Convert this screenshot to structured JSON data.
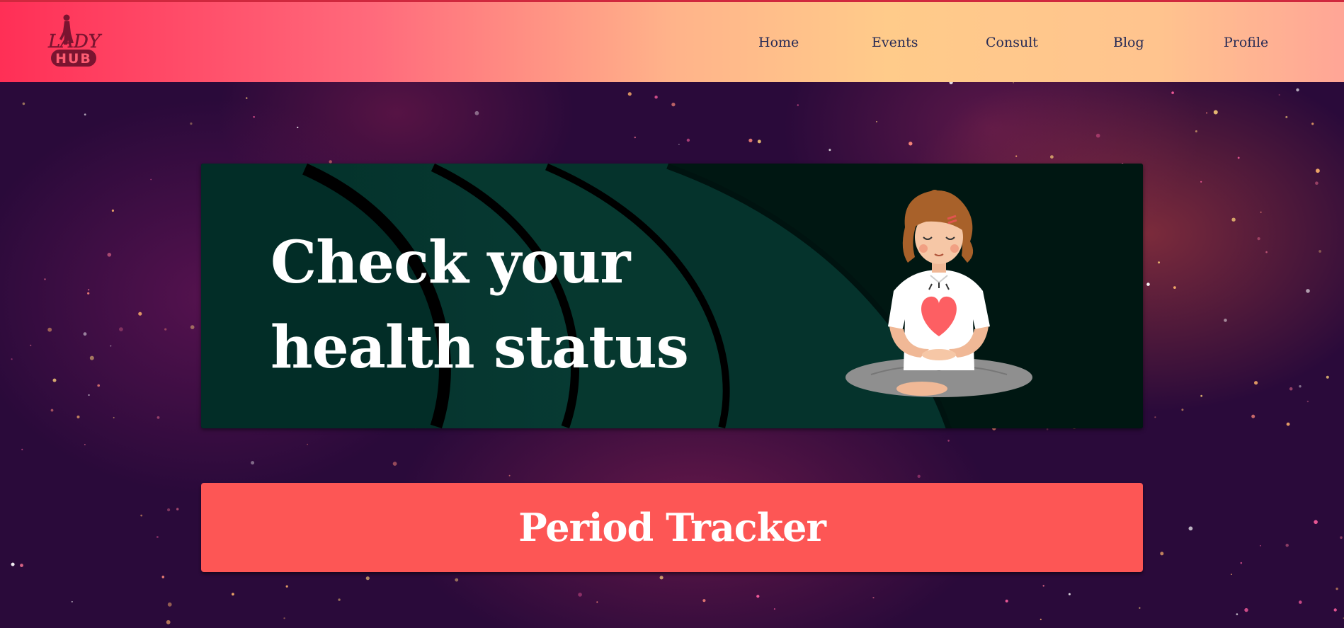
{
  "brand": {
    "logo_text_top": "LADY",
    "logo_text_bottom": "HUB",
    "logo_icon": "woman-silhouette-icon"
  },
  "nav": {
    "items": [
      {
        "label": "Home"
      },
      {
        "label": "Events"
      },
      {
        "label": "Consult"
      },
      {
        "label": "Blog"
      },
      {
        "label": "Profile"
      }
    ]
  },
  "hero": {
    "title": "Check your health status",
    "illustration": "meditating-woman-heart-icon"
  },
  "tracker": {
    "label": "Period Tracker"
  },
  "colors": {
    "accent": "#fd5655",
    "nav_text": "#262a55",
    "hero_bg": "#001a17"
  }
}
